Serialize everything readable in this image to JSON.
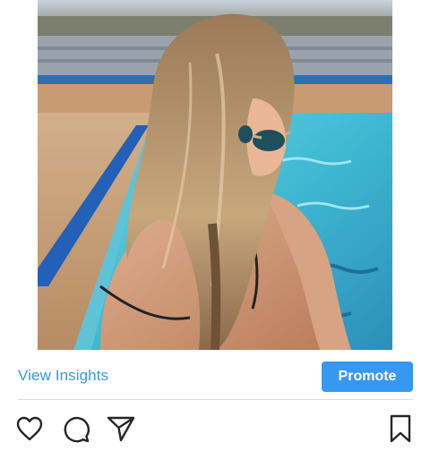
{
  "post": {
    "image_icon": "photo-pool-woman",
    "insights_link": "View Insights",
    "promote_label": "Promote"
  },
  "actions": {
    "like": "heart-icon",
    "comment": "comment-icon",
    "share": "send-icon",
    "save": "bookmark-icon"
  },
  "colors": {
    "accent": "#3897f0",
    "divider": "#dbdbdb",
    "icon": "#262626"
  }
}
